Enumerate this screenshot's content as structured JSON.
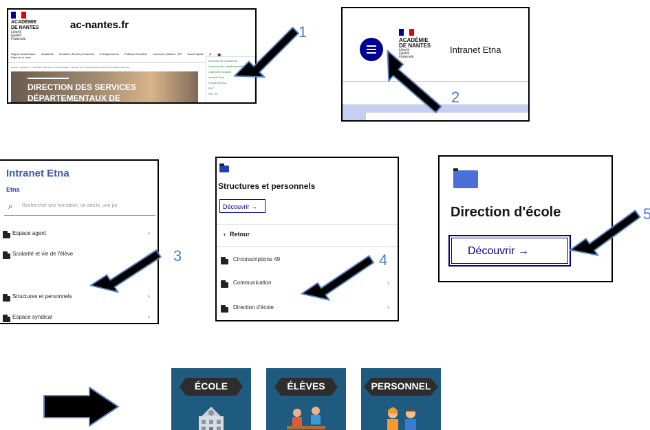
{
  "panel1": {
    "site_title": "ac-nantes.fr",
    "academy": [
      "ACADÉMIE",
      "DE NANTES"
    ],
    "motto": [
      "Liberté",
      "Égalité",
      "Fraternité"
    ],
    "nav": [
      "Région académique Pays de la Loire",
      "Académie",
      "Scolarité | Études | Examens",
      "Enseignements",
      "Politique éducative",
      "Concours | Métiers | RH",
      "Accès rapide"
    ],
    "quick_links": [
      "Annuaire de l'académie",
      "Annuaire des établissements",
      "Calendrier scolaire",
      "Intranet Etna",
      "Portail ARENA",
      "ENT",
      "ENT 49"
    ],
    "breadcrumb": "Accueil > Académie > L'éducation nationale en Loire-Atlantique > Direction des services départementaux de l'éducation nationale",
    "hero_title": [
      "DIRECTION DES SERVICES",
      "DÉPARTEMENTAUX DE"
    ]
  },
  "panel2": {
    "academy": [
      "ACADÉMIE",
      "DE NANTES"
    ],
    "motto": [
      "Liberté",
      "Égalité",
      "Fraternité"
    ],
    "site_title": "Intranet Etna"
  },
  "panel3": {
    "title": "Intranet Etna",
    "subtitle": "Etna",
    "search_placeholder": "Rechercher une formation, un article, une pe",
    "items": [
      "Espace agent",
      "Scolarité et vie de l'élève",
      "Structures et personnels",
      "Espace syndical"
    ]
  },
  "panel4": {
    "title": "Structures et personnels",
    "discover": "Découvrir →",
    "back": "Retour",
    "items": [
      "Circonscriptions 49",
      "Communication",
      "Direction d'école"
    ]
  },
  "panel5": {
    "title": "Direction d'école",
    "discover": "Découvrir →"
  },
  "steps": [
    "1",
    "2",
    "3",
    "4",
    "5"
  ],
  "tiles": [
    "ÉCOLE",
    "ÉLÈVES",
    "PERSONNEL"
  ],
  "colors": {
    "accent": "#000091",
    "number": "#4a7cc9",
    "tile_bg": "#1f5b7e",
    "folder_blue": "#4a6fd8"
  }
}
